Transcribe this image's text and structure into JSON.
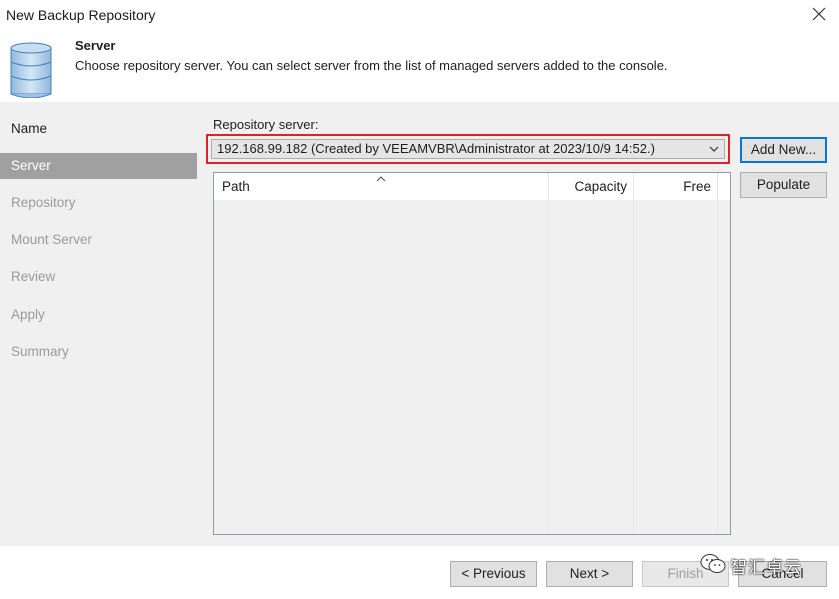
{
  "window": {
    "title": "New Backup Repository"
  },
  "header": {
    "title": "Server",
    "description": "Choose repository server. You can select server from the list of managed servers added to the console."
  },
  "sidebar": {
    "items": [
      {
        "label": "Name",
        "state": "done"
      },
      {
        "label": "Server",
        "state": "active"
      },
      {
        "label": "Repository",
        "state": "pending"
      },
      {
        "label": "Mount Server",
        "state": "pending"
      },
      {
        "label": "Review",
        "state": "pending"
      },
      {
        "label": "Apply",
        "state": "pending"
      },
      {
        "label": "Summary",
        "state": "pending"
      }
    ]
  },
  "main": {
    "repository_label": "Repository server:",
    "repository_value": "192.168.99.182 (Created by VEEAMVBR\\Administrator at 2023/10/9 14:52.)",
    "add_new_label": "Add New...",
    "populate_label": "Populate",
    "table": {
      "columns": [
        "Path",
        "Capacity",
        "Free"
      ],
      "rows": []
    }
  },
  "footer": {
    "previous_label": "< Previous",
    "next_label": "Next >",
    "finish_label": "Finish",
    "cancel_label": "Cancel"
  },
  "watermark": {
    "text": "智汇卓云"
  },
  "colors": {
    "highlight": "#e0212a",
    "accent": "#0078d7",
    "active_nav": "#a0a0a0"
  }
}
